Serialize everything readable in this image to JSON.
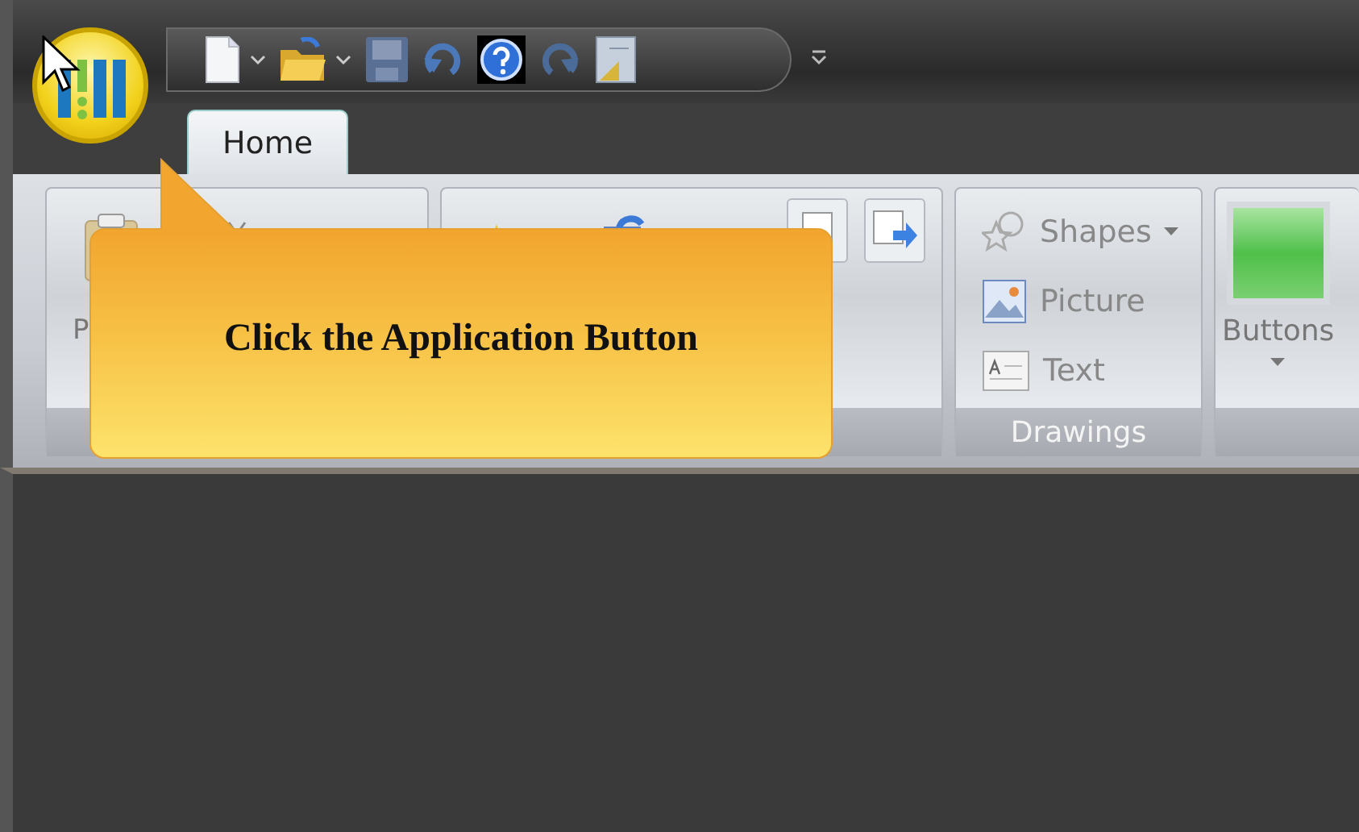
{
  "tabs": [
    {
      "label": "Home",
      "selected": true
    }
  ],
  "ribbon_groups": [
    {
      "kind": "clipboard",
      "paste_label": "P"
    },
    {
      "kind": "file"
    },
    {
      "kind": "drawings",
      "label": "Drawings",
      "items": [
        {
          "kind": "shapes",
          "label": "Shapes",
          "dropdown": true
        },
        {
          "kind": "picture",
          "label": "Picture",
          "dropdown": false
        },
        {
          "kind": "text",
          "label": "Text",
          "dropdown": false
        }
      ]
    },
    {
      "kind": "buttons",
      "label": "Buttons"
    }
  ],
  "callout": {
    "text": "Click the Application Button"
  }
}
